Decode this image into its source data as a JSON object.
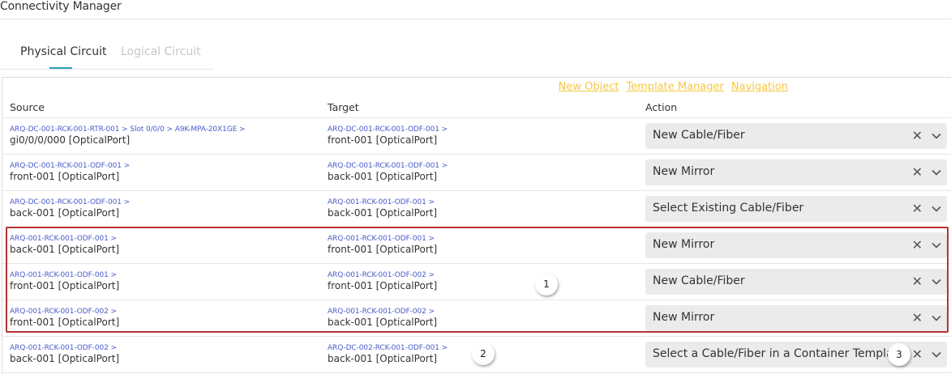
{
  "app": {
    "title": "Connectivity Manager"
  },
  "tabs": [
    {
      "label": "Physical Circuit",
      "active": true
    },
    {
      "label": "Logical Circuit",
      "active": false
    }
  ],
  "links": [
    "New Object",
    "Template Manager",
    "Navigation"
  ],
  "columns": {
    "source": "Source",
    "target": "Target",
    "action": "Action"
  },
  "rows": [
    {
      "source_path": "ARQ-DC-001-RCK-001-RTR-001 > Slot 0/0/0 > A9K-MPA-20X1GE >",
      "source_port": "gi0/0/0/000 [OpticalPort]",
      "target_path": "ARQ-DC-001-RCK-001-ODF-001 >",
      "target_port": "front-001 [OpticalPort]",
      "action": "New Cable/Fiber"
    },
    {
      "source_path": "ARQ-DC-001-RCK-001-ODF-001 >",
      "source_port": "front-001 [OpticalPort]",
      "target_path": "ARQ-DC-001-RCK-001-ODF-001 >",
      "target_port": "back-001 [OpticalPort]",
      "action": "New Mirror"
    },
    {
      "source_path": "ARQ-DC-001-RCK-001-ODF-001 >",
      "source_port": "back-001 [OpticalPort]",
      "target_path": "ARQ-001-RCK-001-ODF-001 >",
      "target_port": "back-001 [OpticalPort]",
      "action": "Select Existing Cable/Fiber"
    },
    {
      "source_path": "ARQ-001-RCK-001-ODF-001 >",
      "source_port": "back-001 [OpticalPort]",
      "target_path": "ARQ-001-RCK-001-ODF-001 >",
      "target_port": "front-001 [OpticalPort]",
      "action": "New Mirror"
    },
    {
      "source_path": "ARQ-001-RCK-001-ODF-001 >",
      "source_port": "front-001 [OpticalPort]",
      "target_path": "ARQ-001-RCK-001-ODF-002 >",
      "target_port": "front-001 [OpticalPort]",
      "action": "New Cable/Fiber"
    },
    {
      "source_path": "ARQ-001-RCK-001-ODF-002 >",
      "source_port": "front-001 [OpticalPort]",
      "target_path": "ARQ-001-RCK-001-ODF-002 >",
      "target_port": "back-001 [OpticalPort]",
      "action": "New Mirror"
    },
    {
      "source_path": "ARQ-001-RCK-001-ODF-002 >",
      "source_port": "back-001 [OpticalPort]",
      "target_path": "ARQ-DC-002-RCK-001-ODF-001 >",
      "target_port": "back-001 [OpticalPort]",
      "action": "Select a Cable/Fiber in a Container Template"
    }
  ],
  "markers": [
    "1",
    "2",
    "3"
  ],
  "icons": {
    "clear": "close-icon",
    "dropdown": "chevron-down-icon"
  },
  "colors": {
    "accent": "#2aa3b8",
    "link": "#f5c842",
    "path": "#4a5bc9",
    "highlight": "#b83232"
  }
}
